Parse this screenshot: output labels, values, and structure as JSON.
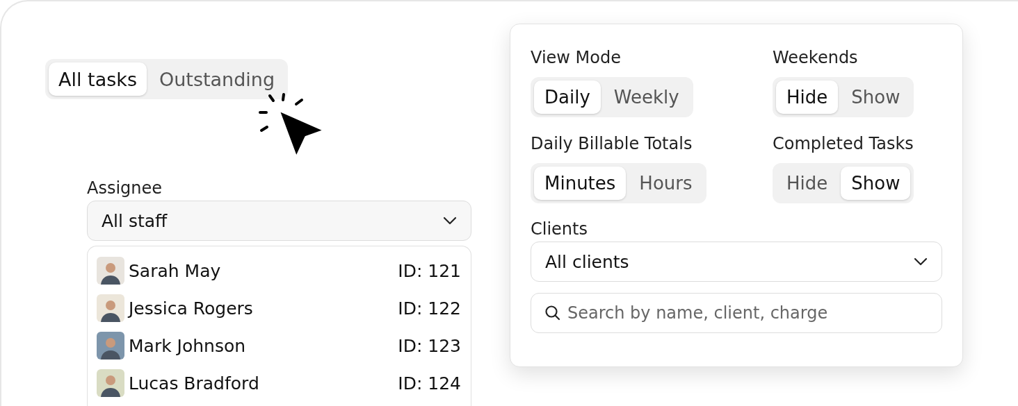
{
  "view_tabs": [
    {
      "label": "All tasks",
      "selected": true
    },
    {
      "label": "Outstanding",
      "selected": false
    }
  ],
  "assignee": {
    "label": "Assignee",
    "value": "All staff",
    "staff": [
      {
        "name": "Sarah May",
        "id": "ID: 121",
        "color": "#e8e4de"
      },
      {
        "name": "Jessica Rogers",
        "id": "ID: 122",
        "color": "#ece6da"
      },
      {
        "name": "Mark Johnson",
        "id": "ID: 123",
        "color": "#7d95ab"
      },
      {
        "name": "Lucas Bradford",
        "id": "ID: 124",
        "color": "#d9dcc3"
      }
    ]
  },
  "settings": {
    "toggles": [
      {
        "label": "View Mode",
        "options": [
          {
            "label": "Daily",
            "selected": true
          },
          {
            "label": "Weekly",
            "selected": false
          }
        ]
      },
      {
        "label": "Weekends",
        "options": [
          {
            "label": "Hide",
            "selected": true
          },
          {
            "label": "Show",
            "selected": false
          }
        ]
      },
      {
        "label": "Daily Billable Totals",
        "options": [
          {
            "label": "Minutes",
            "selected": true
          },
          {
            "label": "Hours",
            "selected": false
          }
        ]
      },
      {
        "label": "Completed Tasks",
        "options": [
          {
            "label": "Hide",
            "selected": false
          },
          {
            "label": "Show",
            "selected": true
          }
        ]
      }
    ],
    "clients": {
      "label": "Clients",
      "value": "All clients"
    },
    "search": {
      "placeholder": "Search by name, client, charge"
    }
  }
}
